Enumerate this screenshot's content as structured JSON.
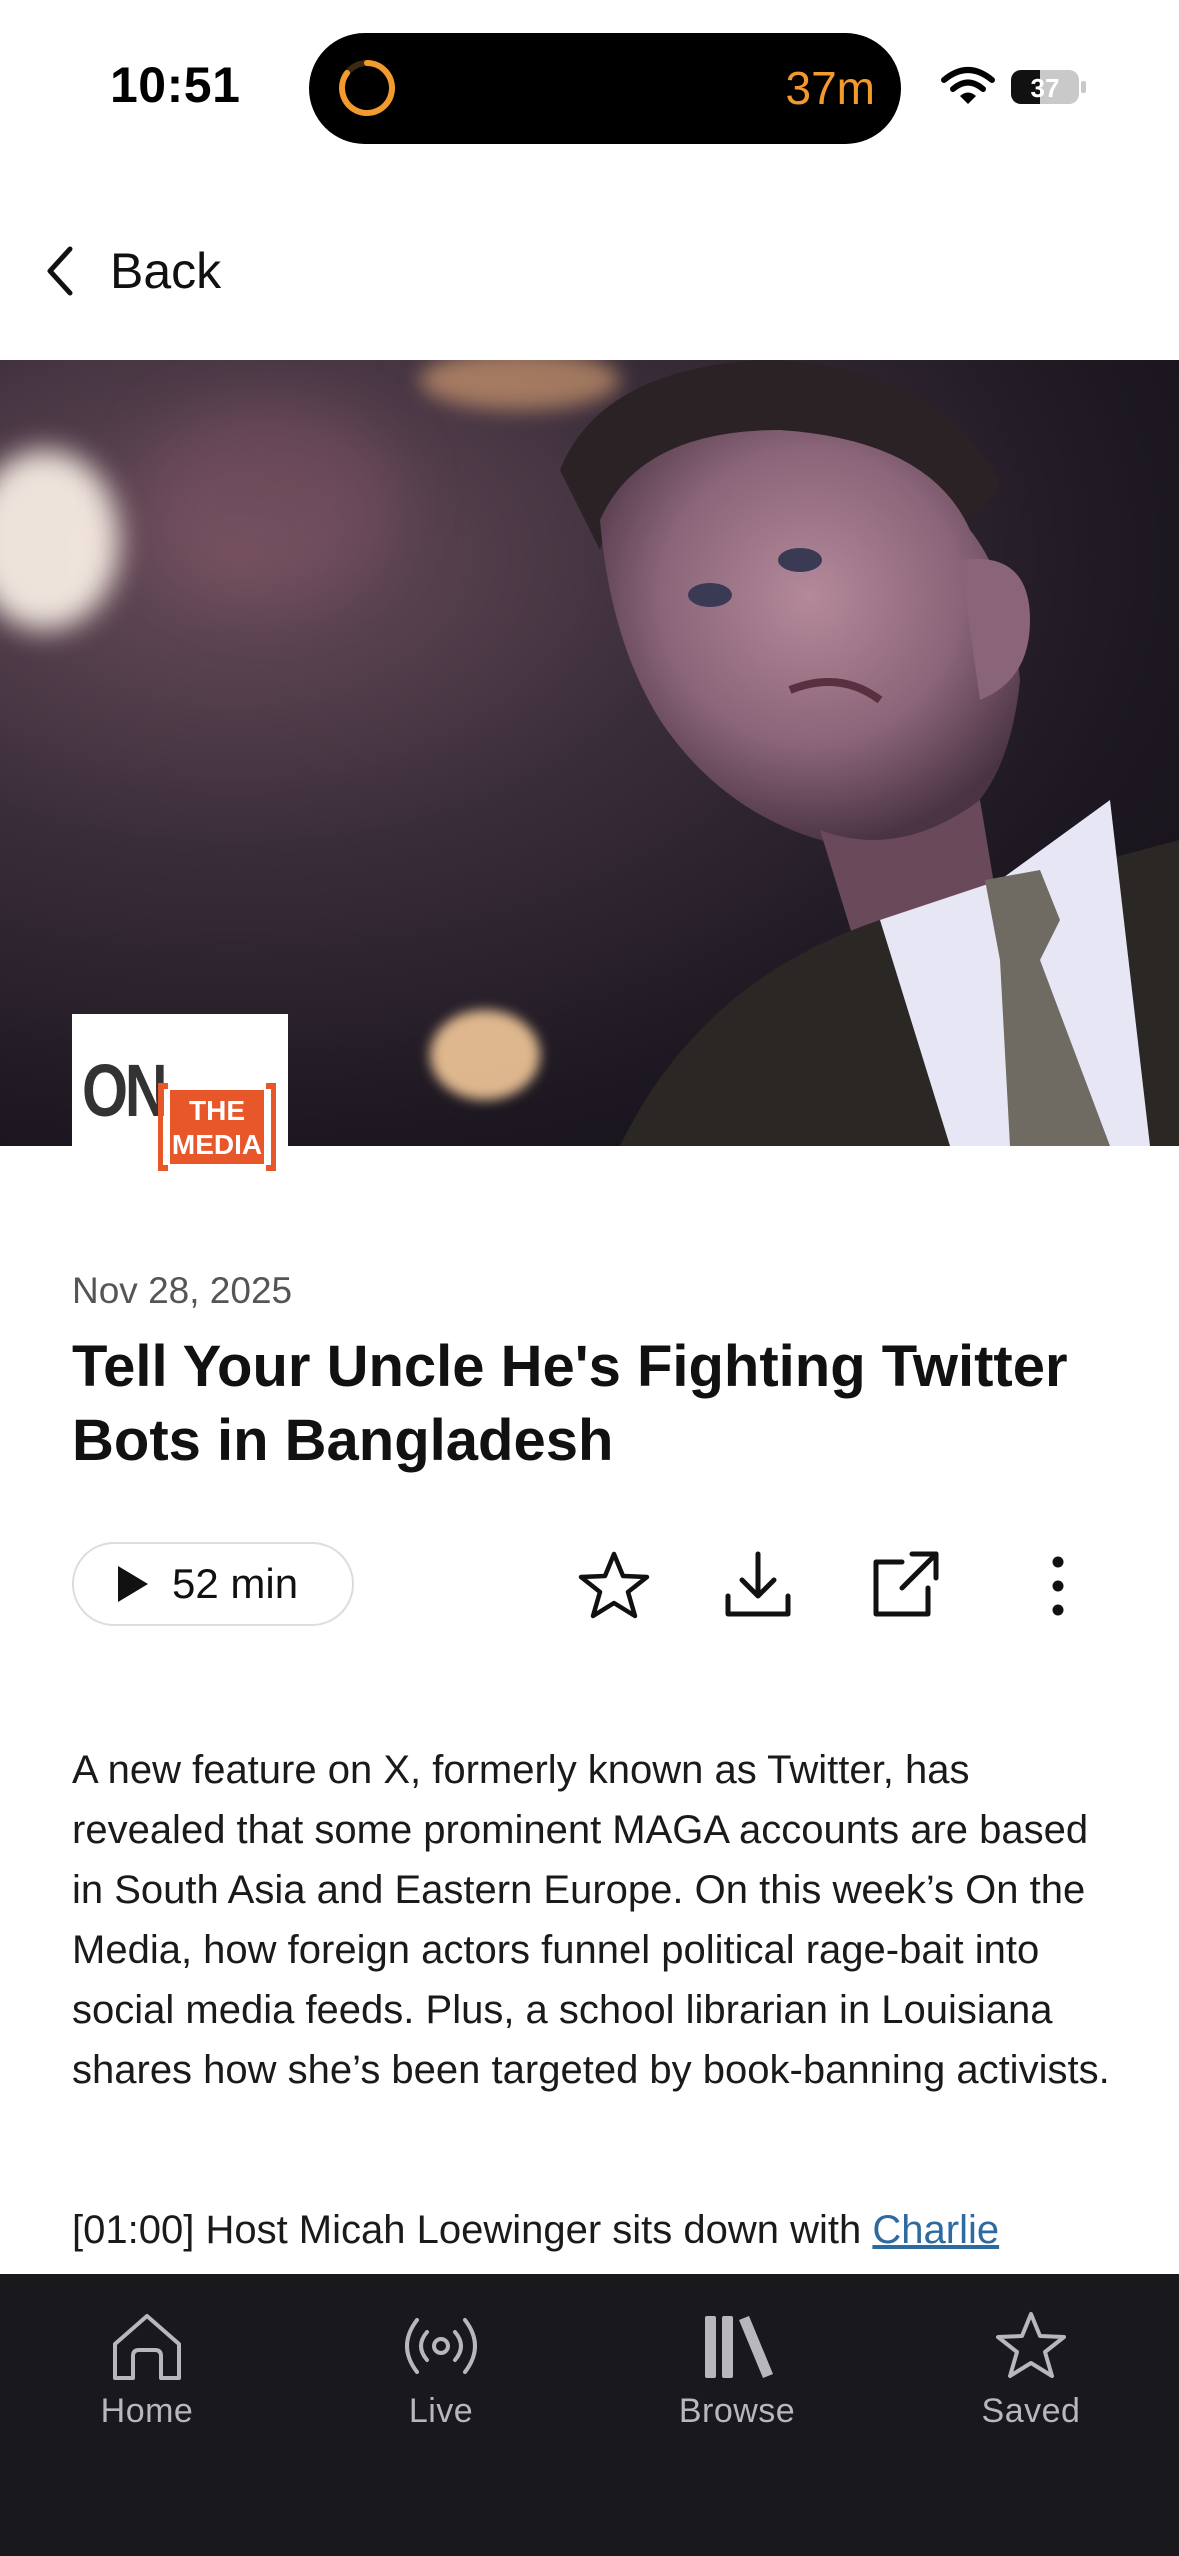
{
  "status_bar": {
    "time": "10:51",
    "timer": "37m",
    "battery_level": "37"
  },
  "nav": {
    "back_label": "Back"
  },
  "hero": {
    "logo_text_on": "ON",
    "logo_text_the": "THE",
    "logo_text_media": "MEDIA"
  },
  "article": {
    "date": "Nov 28, 2025",
    "title": "Tell Your Uncle He's Fighting Twitter Bots in Bangladesh",
    "duration": "52 min",
    "description": "A new feature on X, formerly known as Twitter, has revealed that some prominent MAGA accounts are based in South Asia and Eastern Europe. On this week’s On the Media, how foreign actors funnel political rage-bait into social media feeds. Plus, a school librarian in Louisiana shares how she’s been targeted by book-banning activists.",
    "segment_prefix": "[01:00] Host Micah Loewinger sits down with ",
    "segment_link": "Charlie"
  },
  "actions": {
    "icons": [
      "star-icon",
      "download-icon",
      "share-icon",
      "more-icon"
    ]
  },
  "tab_bar": {
    "tabs": [
      {
        "label": "Home",
        "icon": "home-icon"
      },
      {
        "label": "Live",
        "icon": "broadcast-icon"
      },
      {
        "label": "Browse",
        "icon": "library-icon"
      },
      {
        "label": "Saved",
        "icon": "star-icon"
      }
    ]
  },
  "colors": {
    "timer_orange": "#F29A2E",
    "link_blue": "#2C6AA0",
    "tab_bar_bg": "#19181c",
    "logo_orange": "#E8572A"
  }
}
